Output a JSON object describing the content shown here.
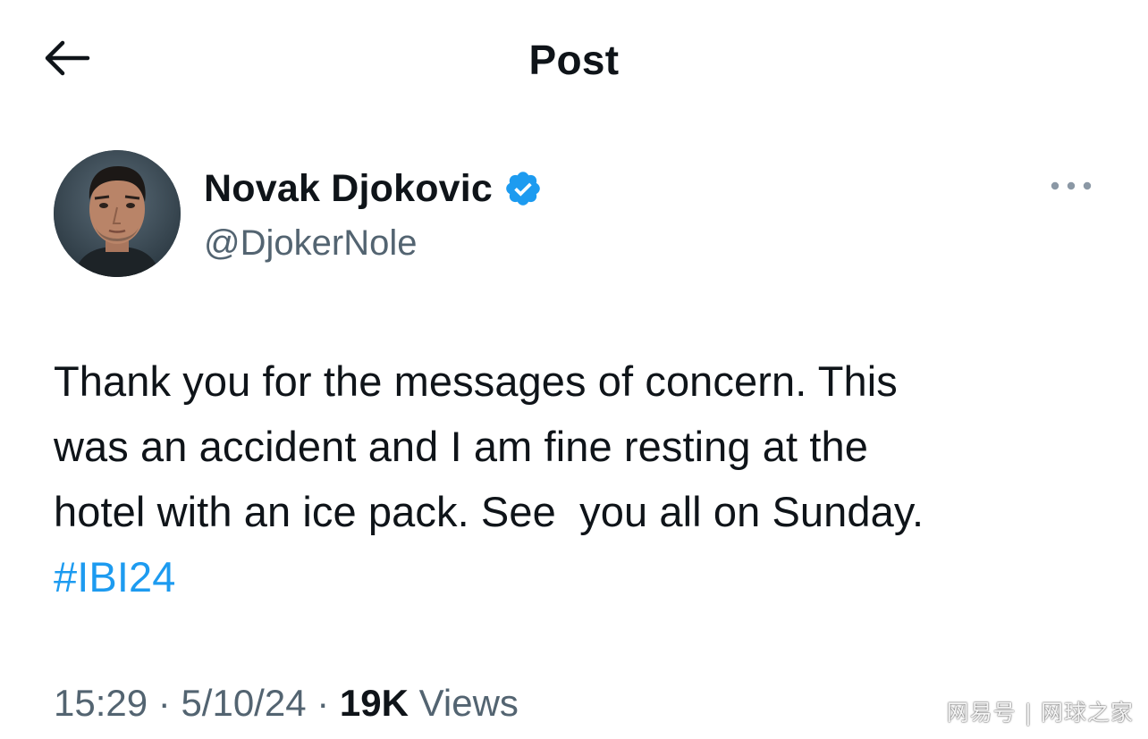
{
  "header": {
    "title": "Post",
    "back_icon": "arrow-left-icon"
  },
  "author": {
    "display_name": "Novak Djokovic",
    "handle": "@DjokerNole",
    "verified_icon": "verified-badge-icon",
    "verified_color": "#1d9bf0"
  },
  "menu": {
    "more_icon": "more-horizontal-icon"
  },
  "post": {
    "text": "Thank you for the messages of concern. This\nwas an accident and I am fine resting at the\nhotel with an ice pack. See  you all on Sunday.\n",
    "hashtag": "#IBI24"
  },
  "meta": {
    "time": "15:29",
    "separator": " · ",
    "date": "5/10/24",
    "views_count": "19K",
    "views_label": " Views"
  },
  "watermark": {
    "text": "网易号 | 网球之家"
  },
  "colors": {
    "text_primary": "#0f1419",
    "text_secondary": "#536471",
    "accent": "#1d9bf0",
    "background": "#ffffff"
  }
}
